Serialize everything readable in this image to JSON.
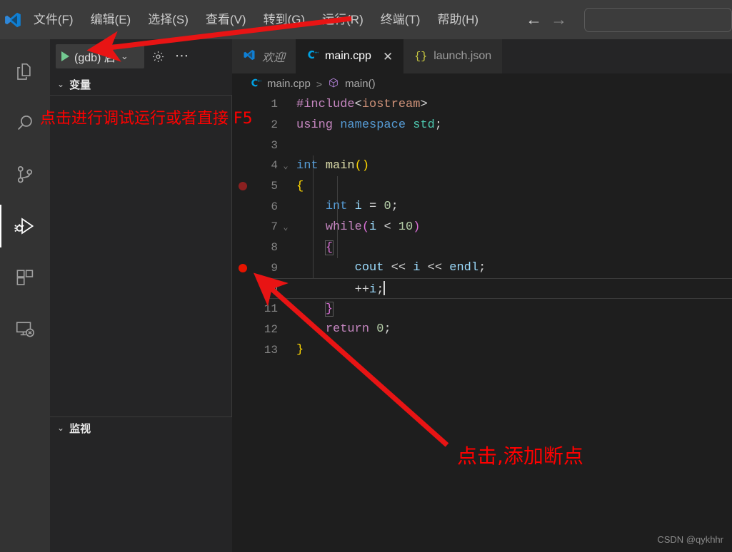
{
  "window": {
    "logo_icon": "vscode-logo-icon"
  },
  "menubar": {
    "items": [
      {
        "label": "文件(F)",
        "name": "menu-file"
      },
      {
        "label": "编辑(E)",
        "name": "menu-edit"
      },
      {
        "label": "选择(S)",
        "name": "menu-selection"
      },
      {
        "label": "查看(V)",
        "name": "menu-view"
      },
      {
        "label": "转到(G)",
        "name": "menu-go"
      },
      {
        "label": "运行(R)",
        "name": "menu-run"
      },
      {
        "label": "终端(T)",
        "name": "menu-terminal"
      },
      {
        "label": "帮助(H)",
        "name": "menu-help"
      }
    ],
    "nav_back": "←",
    "nav_forward": "→",
    "command_center_value": "",
    "command_center_placeholder": ""
  },
  "activitybar": {
    "items": [
      {
        "name": "activity-explorer",
        "icon": "files-icon",
        "active": false
      },
      {
        "name": "activity-search",
        "icon": "search-icon",
        "active": false
      },
      {
        "name": "activity-source-control",
        "icon": "source-control-icon",
        "active": false
      },
      {
        "name": "activity-run-debug",
        "icon": "run-and-debug-icon",
        "active": true
      },
      {
        "name": "activity-extensions",
        "icon": "extensions-icon",
        "active": false
      },
      {
        "name": "activity-remote-explorer",
        "icon": "remote-explorer-icon",
        "active": false
      }
    ]
  },
  "sidebar": {
    "toolbar": {
      "run_icon": "play-icon",
      "config_label": "(gdb) 启",
      "dropdown_icon": "chevron-down-icon",
      "settings_icon": "gear-icon",
      "more_icon": "ellipsis-icon"
    },
    "sections": [
      {
        "name": "variables-section",
        "title": "变量",
        "twisty": "⌄",
        "items": []
      },
      {
        "name": "watch-section",
        "title": "监视",
        "twisty": "⌄",
        "items": []
      }
    ]
  },
  "tabs": [
    {
      "name": "tab-welcome",
      "label": "欢迎",
      "icon": "vscode-logo-icon",
      "active": false,
      "italic": true,
      "closable": false
    },
    {
      "name": "tab-main-cpp",
      "label": "main.cpp",
      "icon": "cpp-file-icon",
      "active": true,
      "italic": false,
      "closable": true,
      "close_glyph": "✕"
    },
    {
      "name": "tab-launch-json",
      "label": "launch.json",
      "icon": "json-file-icon",
      "icon_glyph": "{}",
      "active": false,
      "italic": false,
      "closable": false
    }
  ],
  "breadcrumb": {
    "file_icon": "cpp-file-icon",
    "file": "main.cpp",
    "separator": ">",
    "symbol_icon": "symbol-method-icon",
    "symbol": "main()"
  },
  "editor": {
    "cursor_line": 10,
    "lines": [
      {
        "num": "1",
        "breakpoint": "none",
        "fold": "",
        "current": false
      },
      {
        "num": "2",
        "breakpoint": "none",
        "fold": "",
        "current": false
      },
      {
        "num": "3",
        "breakpoint": "none",
        "fold": "",
        "current": false
      },
      {
        "num": "4",
        "breakpoint": "none",
        "fold": "⌄",
        "current": false
      },
      {
        "num": "5",
        "breakpoint": "inactive",
        "fold": "",
        "current": false
      },
      {
        "num": "6",
        "breakpoint": "none",
        "fold": "",
        "current": false
      },
      {
        "num": "7",
        "breakpoint": "none",
        "fold": "⌄",
        "current": false
      },
      {
        "num": "8",
        "breakpoint": "none",
        "fold": "",
        "current": false
      },
      {
        "num": "9",
        "breakpoint": "active",
        "fold": "",
        "current": false
      },
      {
        "num": "10",
        "breakpoint": "none",
        "fold": "",
        "current": true
      },
      {
        "num": "11",
        "breakpoint": "none",
        "fold": "",
        "current": false
      },
      {
        "num": "12",
        "breakpoint": "none",
        "fold": "",
        "current": false
      },
      {
        "num": "13",
        "breakpoint": "none",
        "fold": "",
        "current": false
      }
    ],
    "source": [
      "#include<iostream>",
      "using namespace std;",
      "",
      "int main()",
      "{",
      "    int i = 0;",
      "    while(i < 10)",
      "    {",
      "        cout << i << endl;",
      "        ++i;",
      "    }",
      "    return 0;",
      "}"
    ]
  },
  "annotations": [
    {
      "name": "annotation-run-debug",
      "text": "点击进行调试运行或者直接 F5",
      "color": "#ff0000"
    },
    {
      "name": "annotation-add-breakpoint",
      "text": "点击,添加断点",
      "color": "#ff0000"
    }
  ],
  "watermark": {
    "text": "CSDN @qykhhr"
  },
  "colors": {
    "titlebar_bg": "#3c3c3c",
    "activitybar_bg": "#333333",
    "sidebar_bg": "#252526",
    "editor_bg": "#1e1e1e",
    "tab_active_bg": "#1e1e1e",
    "tab_inactive_bg": "#2d2d2d",
    "accent_red": "#ff0000",
    "breakpoint_active": "#e51400",
    "breakpoint_inactive": "#8b2020",
    "play_green": "#73c991"
  }
}
